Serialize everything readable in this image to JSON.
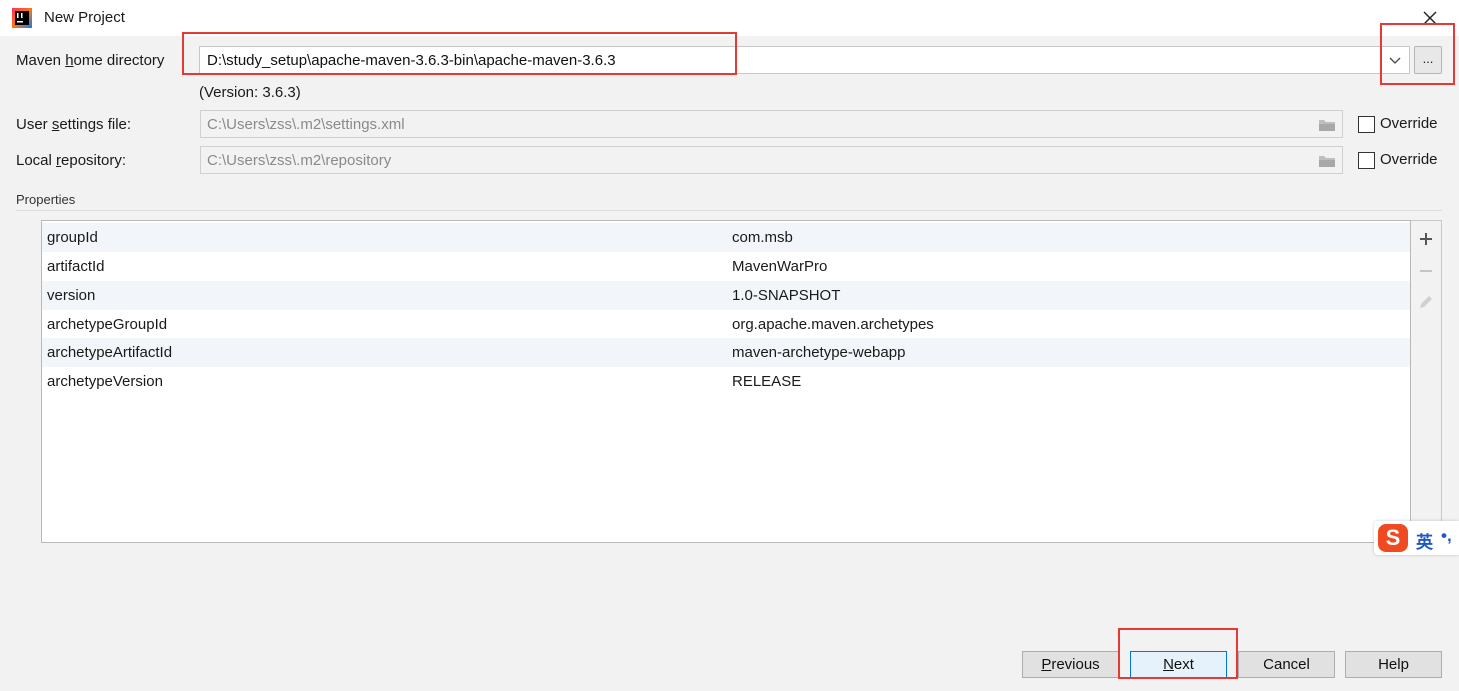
{
  "window": {
    "title": "New Project",
    "close_glyph": "✕"
  },
  "maven_home": {
    "label_prefix": "Maven ",
    "label_mnemonic": "h",
    "label_suffix": "ome directory",
    "value": "D:\\study_setup\\apache-maven-3.6.3-bin\\apache-maven-3.6.3",
    "browse_label": "...",
    "version_text": "(Version: 3.6.3)"
  },
  "user_settings": {
    "label_prefix": "User ",
    "label_mnemonic": "s",
    "label_suffix": "ettings file:",
    "value": "C:\\Users\\zss\\.m2\\settings.xml",
    "override_label": "Override",
    "override_checked": false
  },
  "local_repo": {
    "label_prefix": "Local ",
    "label_mnemonic": "r",
    "label_suffix": "epository:",
    "value": "C:\\Users\\zss\\.m2\\repository",
    "override_label": "Override",
    "override_checked": false
  },
  "properties": {
    "section_label": "Properties",
    "rows": [
      {
        "key": "groupId",
        "value": "com.msb"
      },
      {
        "key": "artifactId",
        "value": "MavenWarPro"
      },
      {
        "key": "version",
        "value": "1.0-SNAPSHOT"
      },
      {
        "key": "archetypeGroupId",
        "value": "org.apache.maven.archetypes"
      },
      {
        "key": "archetypeArtifactId",
        "value": "maven-archetype-webapp"
      },
      {
        "key": "archetypeVersion",
        "value": "RELEASE"
      }
    ],
    "toolbar_icons": [
      "plus-icon",
      "minus-icon",
      "pencil-icon"
    ]
  },
  "buttons": {
    "previous_mnemonic": "P",
    "previous_rest": "revious",
    "next_mnemonic": "N",
    "next_rest": "ext",
    "cancel": "Cancel",
    "help": "Help"
  },
  "ime": {
    "logo": "S",
    "lang": "英",
    "punc": "•,"
  },
  "colors": {
    "highlight": "#e53935",
    "primary_border": "#0078d7",
    "ime_brand": "#f04a23"
  }
}
